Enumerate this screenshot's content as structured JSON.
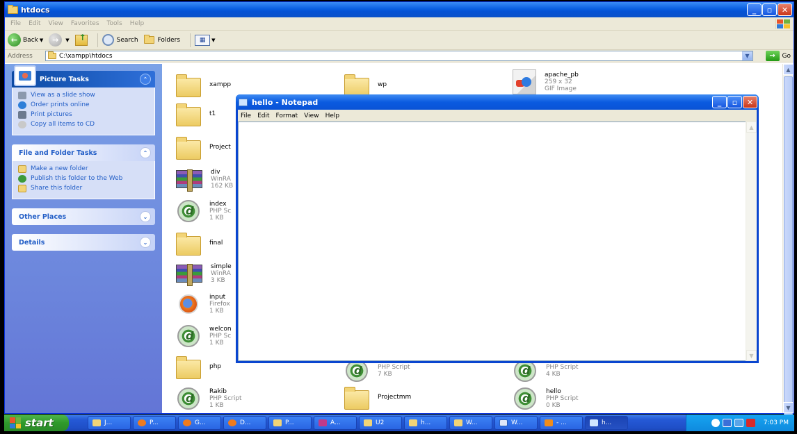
{
  "explorer": {
    "title": "htdocs",
    "menu": [
      "File",
      "Edit",
      "View",
      "Favorites",
      "Tools",
      "Help"
    ],
    "toolbar": {
      "back": "Back",
      "search": "Search",
      "folders": "Folders"
    },
    "address": {
      "label": "Address",
      "value": "C:\\xampp\\htdocs",
      "go": "Go"
    },
    "window_buttons": {
      "min": "_",
      "max": "▫",
      "close": "✕"
    }
  },
  "taskpane": {
    "picture_tasks": {
      "title": "Picture Tasks",
      "items": [
        "View as a slide show",
        "Order prints online",
        "Print pictures",
        "Copy all items to CD"
      ]
    },
    "file_folder_tasks": {
      "title": "File and Folder Tasks",
      "items": [
        "Make a new folder",
        "Publish this folder to the Web",
        "Share this folder"
      ]
    },
    "other_places": {
      "title": "Other Places"
    },
    "details": {
      "title": "Details"
    }
  },
  "files": [
    {
      "name": "xampp",
      "type": "",
      "size": "",
      "icon": "folder-icon"
    },
    {
      "name": "wp",
      "type": "",
      "size": "",
      "icon": "folder-icon"
    },
    {
      "name": "apache_pb",
      "type": "259 x 32",
      "size": "GIF Image",
      "icon": "gif-image-icon"
    },
    {
      "name": "t1",
      "type": "",
      "size": "",
      "icon": "folder-icon"
    },
    {
      "name": "Project",
      "type": "",
      "size": "",
      "icon": "folder-icon"
    },
    {
      "name": "div",
      "type": "WinRA",
      "size": "162 KB",
      "icon": "winrar-archive-icon"
    },
    {
      "name": "index",
      "type": "PHP Sc",
      "size": "1 KB",
      "icon": "php-script-icon"
    },
    {
      "name": "final",
      "type": "",
      "size": "",
      "icon": "folder-icon"
    },
    {
      "name": "simple",
      "type": "WinRA",
      "size": "3 KB",
      "icon": "winrar-archive-icon"
    },
    {
      "name": "input",
      "type": "Firefox",
      "size": "1 KB",
      "icon": "firefox-icon"
    },
    {
      "name": "welcon",
      "type": "PHP Sc",
      "size": "1 KB",
      "icon": "php-script-icon"
    },
    {
      "name": "php",
      "type": "",
      "size": "",
      "icon": "folder-icon"
    },
    {
      "name": "",
      "type": "PHP Script",
      "size": "7 KB",
      "icon": "php-script-icon"
    },
    {
      "name": "",
      "type": "PHP Script",
      "size": "4 KB",
      "icon": "php-script-icon"
    },
    {
      "name": "Rakib",
      "type": "PHP Script",
      "size": "1 KB",
      "icon": "php-script-icon"
    },
    {
      "name": "Projectmm",
      "type": "",
      "size": "",
      "icon": "folder-icon"
    },
    {
      "name": "hello",
      "type": "PHP Script",
      "size": "0 KB",
      "icon": "php-script-icon"
    }
  ],
  "notepad": {
    "title": "hello - Notepad",
    "menu": [
      "File",
      "Edit",
      "Format",
      "View",
      "Help"
    ],
    "content": ""
  },
  "taskbar": {
    "start": "start",
    "buttons": [
      {
        "label": "J...",
        "icon": "folder-icon"
      },
      {
        "label": "P...",
        "icon": "firefox-icon"
      },
      {
        "label": "G...",
        "icon": "firefox-icon"
      },
      {
        "label": "D...",
        "icon": "firefox-icon"
      },
      {
        "label": "P...",
        "icon": "folder-icon"
      },
      {
        "label": "A...",
        "icon": "app-icon"
      },
      {
        "label": "U2",
        "icon": "folder-icon"
      },
      {
        "label": "h...",
        "icon": "folder-icon"
      },
      {
        "label": "W...",
        "icon": "folder-icon"
      },
      {
        "label": "W...",
        "icon": "word-icon"
      },
      {
        "label": "- ...",
        "icon": "vlc-icon"
      },
      {
        "label": "h...",
        "icon": "notepad-icon"
      }
    ],
    "clock": "7:03 PM"
  }
}
